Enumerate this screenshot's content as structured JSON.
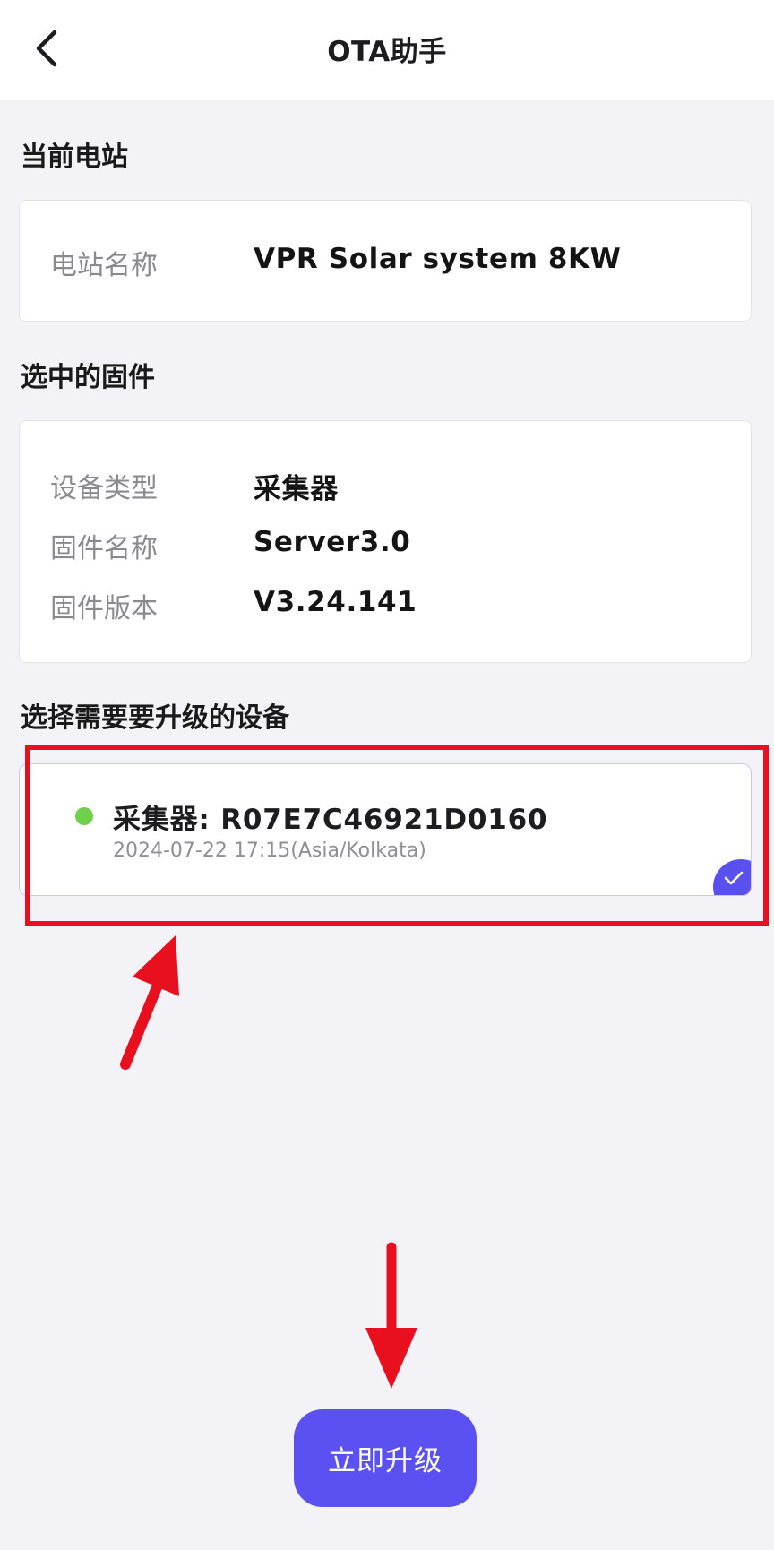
{
  "header": {
    "title": "OTA助手",
    "back_icon": "chevron-left-icon"
  },
  "station_section": {
    "title": "当前电站",
    "name_label": "电站名称",
    "name_value": "VPR Solar system 8KW"
  },
  "firmware_section": {
    "title": "选中的固件",
    "rows": [
      {
        "label": "设备类型",
        "value": "采集器"
      },
      {
        "label": "固件名称",
        "value": "Server3.0"
      },
      {
        "label": "固件版本",
        "value": "V3.24.141"
      }
    ]
  },
  "device_section": {
    "title": "选择需要要升级的设备",
    "devices": [
      {
        "name": "采集器: R07E7C46921D0160",
        "time": "2024-07-22 17:15(Asia/Kolkata)",
        "status_color": "#6fd14b",
        "selected": true
      }
    ]
  },
  "actions": {
    "upgrade_label": "立即升级"
  },
  "colors": {
    "accent": "#5b50f2",
    "annotation": "#e8101e",
    "online": "#6fd14b"
  }
}
